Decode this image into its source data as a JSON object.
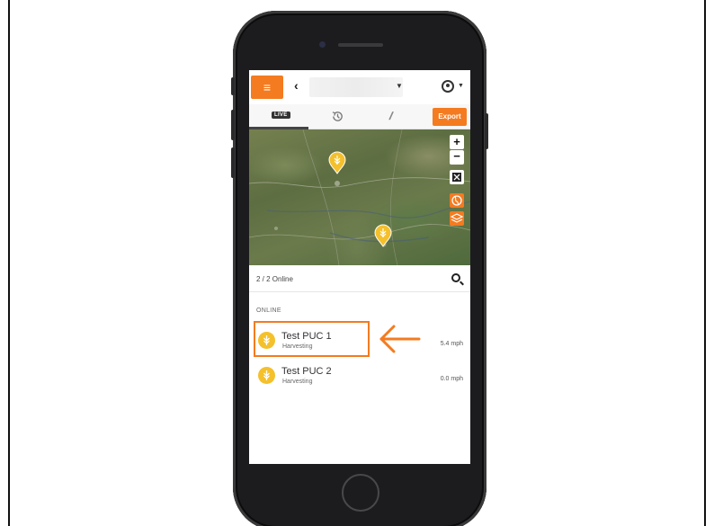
{
  "app": {
    "back_symbol": "‹",
    "farm_select_value": "",
    "tabs": [
      {
        "label": "LIVE",
        "icon": "live-badge"
      },
      {
        "label": "",
        "icon": "history-icon"
      },
      {
        "label": "",
        "icon": "pattern-icon"
      }
    ],
    "export_label": "Export"
  },
  "map": {
    "zoom_in": "+",
    "zoom_out": "−",
    "controls": [
      "fullscreen-icon",
      "globe-icon",
      "layers-icon"
    ],
    "pin_icon": "wheat-icon"
  },
  "list": {
    "online_count": "2 / 2 Online",
    "section_title": "ONLINE",
    "machines": [
      {
        "name": "Test PUC 1",
        "status": "Harvesting",
        "speed": "5.4 mph"
      },
      {
        "name": "Test PUC 2",
        "status": "Harvesting",
        "speed": "0.0 mph"
      }
    ]
  },
  "colors": {
    "accent": "#f47b20",
    "pin": "#f4c02c",
    "phone_body": "#1c1c1e"
  }
}
